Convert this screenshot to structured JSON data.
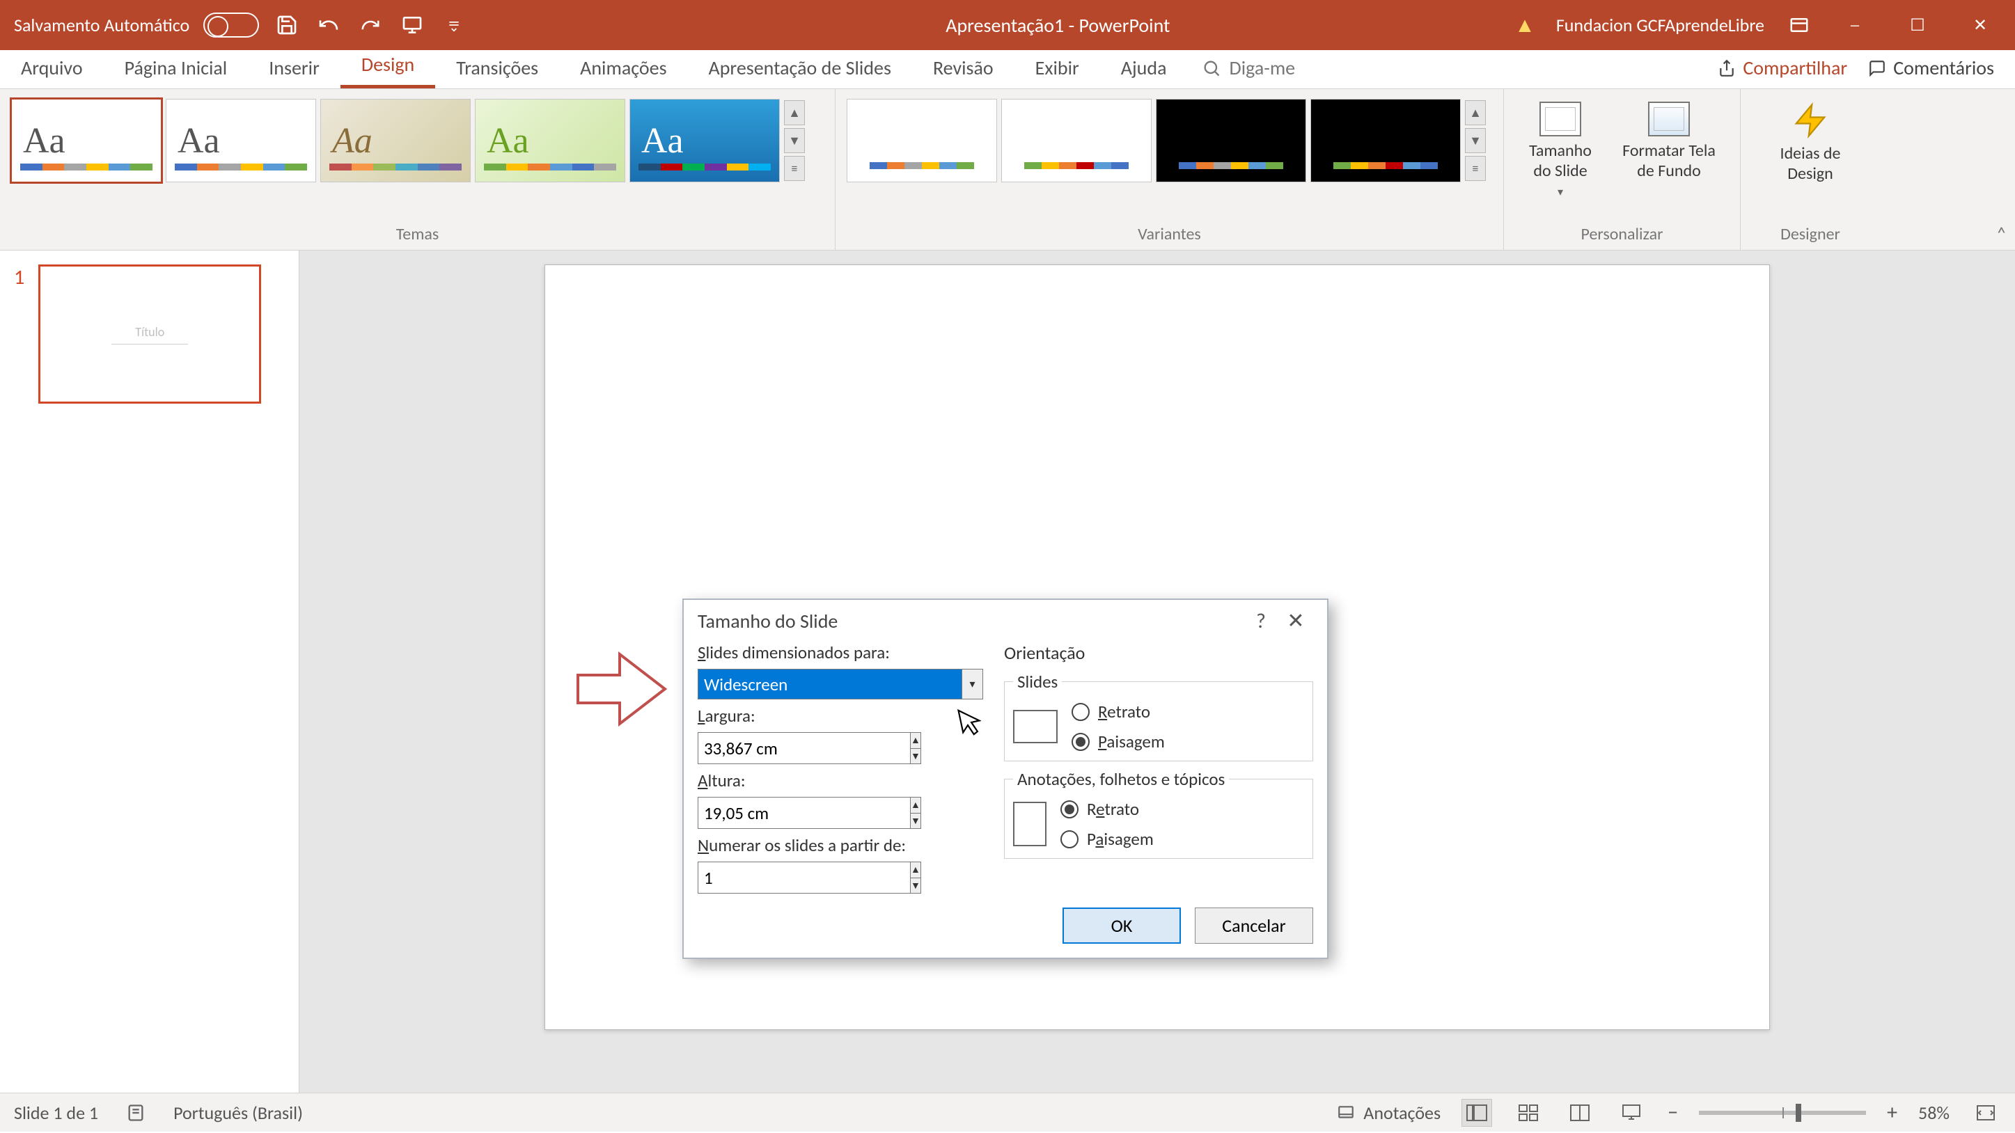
{
  "titlebar": {
    "autosave_label": "Salvamento Automático",
    "doc_title": "Apresentação1 - PowerPoint",
    "account_name": "Fundacion GCFAprendeLibre"
  },
  "tabs": {
    "file": "Arquivo",
    "home": "Página Inicial",
    "insert": "Inserir",
    "design": "Design",
    "transitions": "Transições",
    "animations": "Animações",
    "slideshow": "Apresentação de Slides",
    "review": "Revisão",
    "view": "Exibir",
    "help": "Ajuda",
    "tellme": "Diga-me",
    "share": "Compartilhar",
    "comments": "Comentários"
  },
  "ribbon": {
    "themes_group": "Temas",
    "variants_group": "Variantes",
    "customize_group": "Personalizar",
    "designer_group": "Designer",
    "slide_size": "Tamanho do Slide",
    "format_bg": "Formatar Tela de Fundo",
    "design_ideas": "Ideias de Design"
  },
  "slidepanel": {
    "slide_number": "1",
    "mini_title": "Título"
  },
  "dialog": {
    "title": "Tamanho do Slide",
    "sized_for_label": "Slides dimensionados para:",
    "sized_for_value": "Widescreen",
    "width_label": "Largura:",
    "width_value": "33,867 cm",
    "height_label": "Altura:",
    "height_value": "19,05 cm",
    "number_from_label": "Numerar os slides a partir de:",
    "number_from_value": "1",
    "orientation_label": "Orientação",
    "slides_legend": "Slides",
    "notes_legend": "Anotações, folhetos e tópicos",
    "portrait": "Retrato",
    "landscape": "Paisagem",
    "ok": "OK",
    "cancel": "Cancelar"
  },
  "statusbar": {
    "slide_info": "Slide 1 de 1",
    "language": "Português (Brasil)",
    "notes": "Anotações",
    "zoom": "58%"
  },
  "colors": {
    "accent": "#b7472a",
    "selection": "#0078d7"
  }
}
